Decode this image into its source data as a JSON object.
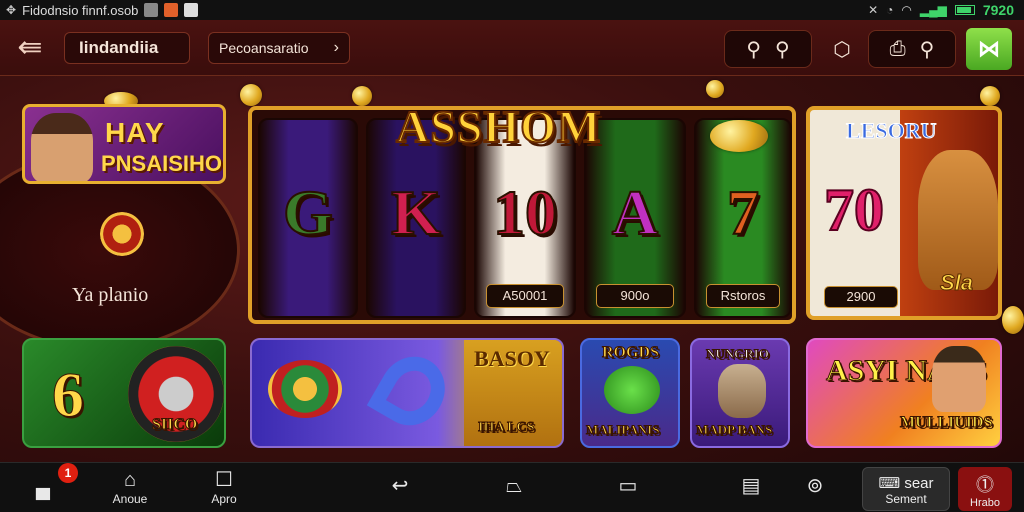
{
  "status_bar": {
    "app_text": "Fidodnsio finnf.osob",
    "time": "7920"
  },
  "app_bar": {
    "title": "Iindandiia",
    "breadcrumb": "Pecoansaratio",
    "colors": {
      "background": "#4a1210",
      "accent_green": "#6cc83a"
    }
  },
  "hero_banner": {
    "line1": "HAY",
    "line2": "PNSAISIHO"
  },
  "promo_label": "Ya planio",
  "slot_machine": {
    "title": "ASSHOM",
    "reels": [
      {
        "symbol": "G",
        "value": "",
        "color": "#3a7a2a",
        "bg": "#3a1a7a"
      },
      {
        "symbol": "K",
        "value": "",
        "color": "#d02050",
        "bg": "#2a1260"
      },
      {
        "symbol": "10",
        "value": "A50001",
        "color": "#c01838",
        "bg": "#f4ece0"
      },
      {
        "symbol": "A",
        "value": "900o",
        "color": "#c030c0",
        "bg": "#1f6a1a"
      },
      {
        "symbol": "7",
        "value": "Rstoros",
        "color": "#e06020",
        "bg": "#2a8a22"
      }
    ]
  },
  "side_game": {
    "title": "LESORU",
    "number": "70",
    "value": "2900",
    "signature": "Sla"
  },
  "game_tiles": [
    {
      "label": "6",
      "sub": "SIICO"
    },
    {
      "label": "",
      "sub": ""
    },
    {
      "label": "BASOY",
      "sub": "IHA LCS"
    },
    {
      "label": "ROGDS",
      "sub": "MALIPANIS"
    },
    {
      "label": "NUNGRIO",
      "sub": "MADP BANS"
    },
    {
      "label": "ASYI NAUS",
      "sub": "MULLIUIDS"
    }
  ],
  "nav_bar": {
    "items": [
      {
        "icon": "store-icon",
        "label": ""
      },
      {
        "icon": "home-icon",
        "label": "Anoue"
      },
      {
        "icon": "square-icon",
        "label": "Apro"
      },
      {
        "icon": "back-icon",
        "label": ""
      },
      {
        "icon": "home-outline-icon",
        "label": ""
      },
      {
        "icon": "recent-icon",
        "label": ""
      },
      {
        "icon": "save-icon",
        "label": ""
      },
      {
        "icon": "help-icon",
        "label": ""
      }
    ],
    "badge": "1",
    "sear_label": "sear",
    "sear_sub": "Sement",
    "alert_label": "Hrabo"
  }
}
